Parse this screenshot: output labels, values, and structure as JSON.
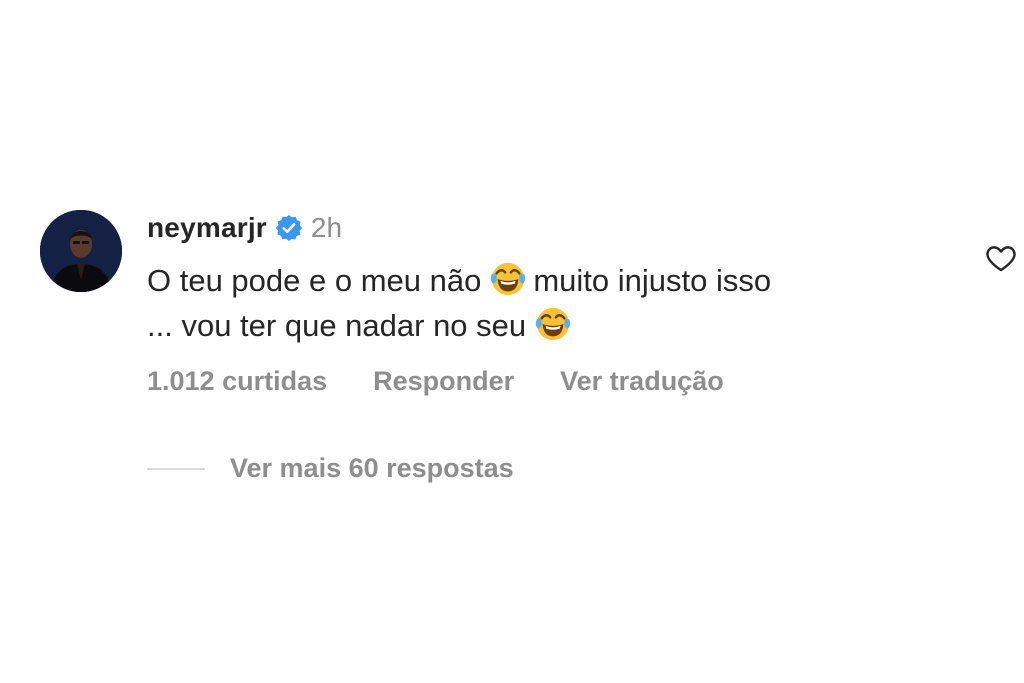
{
  "comment": {
    "username": "neymarjr",
    "verified": true,
    "time": "2h",
    "text_line1_a": "O teu pode e o meu não",
    "text_line1_b": "muito injusto isso",
    "text_line2": "... vou ter que nadar no seu",
    "emoji": "face-with-tears-of-joy",
    "likes": "1.012 curtidas",
    "reply_label": "Responder",
    "translate_label": "Ver tradução",
    "view_replies_label": "Ver mais 60 respostas"
  },
  "colors": {
    "primary_text": "#262626",
    "secondary_text": "#8e8e8e",
    "verified_badge": "#3897f0",
    "divider": "#dbdbdb"
  },
  "icons": {
    "verified": "verified-badge-icon",
    "like": "heart-icon"
  }
}
